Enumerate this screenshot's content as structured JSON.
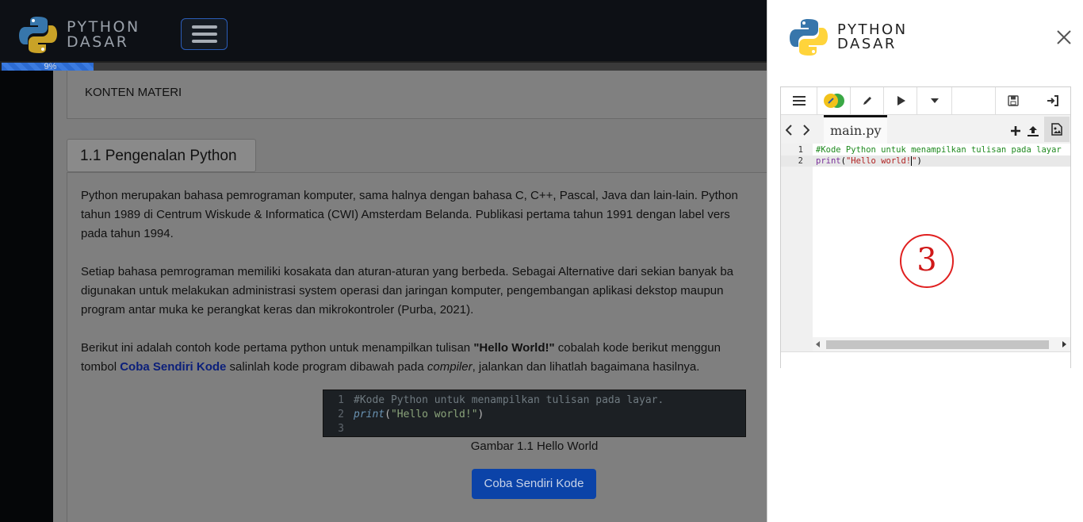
{
  "navbar": {
    "brand_line1": "PYTHON",
    "brand_line2": "DASAR",
    "menu_icon": "hamburger-icon"
  },
  "progress": {
    "label": "9%",
    "value": 0.12
  },
  "content": {
    "konten_title": "KONTEN MATERI",
    "section_title": "1.1 Pengenalan Python",
    "p1_l1": "Python merupakan bahasa pemrograman komputer, sama halnya dengan bahasa C, C++, Pascal, Java dan lain-lain. Python",
    "p1_l2": "tahun 1989 di Centrum Wiskude & Informatica (CWI) Amsterdam Belanda. Publikasi pertama tahun 1991 dengan label vers",
    "p1_l3": "pada tahun 1994.",
    "p2_l1": "Setiap bahasa pemrograman memiliki kosakata dan aturan-aturan yang berbeda. Sebagai Alternative dari sekian banyak ba",
    "p2_l2": "digunakan untuk melakukan administrasi system operasi dan jaringan komputer, pengembangan aplikasi dekstop maupun",
    "p2_l3": "program antar muka ke perangkat keras dan mikrokontroler (Purba, 2021).",
    "p3_l1_a": "Berikut ini adalah contoh kode pertama python untuk menampilkan tulisan ",
    "p3_l1_b": "\"Hello World!\"",
    "p3_l1_c": " cobalah kode berikut menggun",
    "p3_l2_a": "tombol ",
    "p3_l2_link": "Coba Sendiri Kode",
    "p3_l2_b": " salinlah kode program dibawah pada ",
    "p3_l2_em": "compiler",
    "p3_l2_c": ", jalankan dan lihatlah bagaimana hasilnya.",
    "code": {
      "ln1": "1",
      "ln2": "2",
      "ln3": "3",
      "line1": "#Kode Python untuk menampilkan tulisan pada layar.",
      "line2_kw": "print",
      "line2_open": "(",
      "line2_str": "\"Hello world!\"",
      "line2_close": ")"
    },
    "caption": "Gambar 1.1 Hello World",
    "try_button": "Coba Sendiri Kode"
  },
  "panel": {
    "brand_line1": "PYTHON",
    "brand_line2": "DASAR",
    "close_icon": "close-icon",
    "ide": {
      "toolbar_icons": [
        "menu-icon",
        "python-logo-icon",
        "pencil-icon",
        "play-icon",
        "dropdown-icon",
        "save-icon",
        "login-icon"
      ],
      "file_tab": "main.py",
      "editor_ln1": "1",
      "editor_ln2": "2",
      "editor_line1": "#Kode Python untuk menampilkan tulisan pada layar",
      "editor_line2_kw": "print",
      "editor_line2_open": "(",
      "editor_line2_str": "\"Hello world!",
      "editor_line2_str_end": "\"",
      "editor_line2_close": ")",
      "annotation": "3"
    }
  },
  "colors": {
    "accent": "#0b43a8",
    "annotation_red": "#e02020"
  }
}
